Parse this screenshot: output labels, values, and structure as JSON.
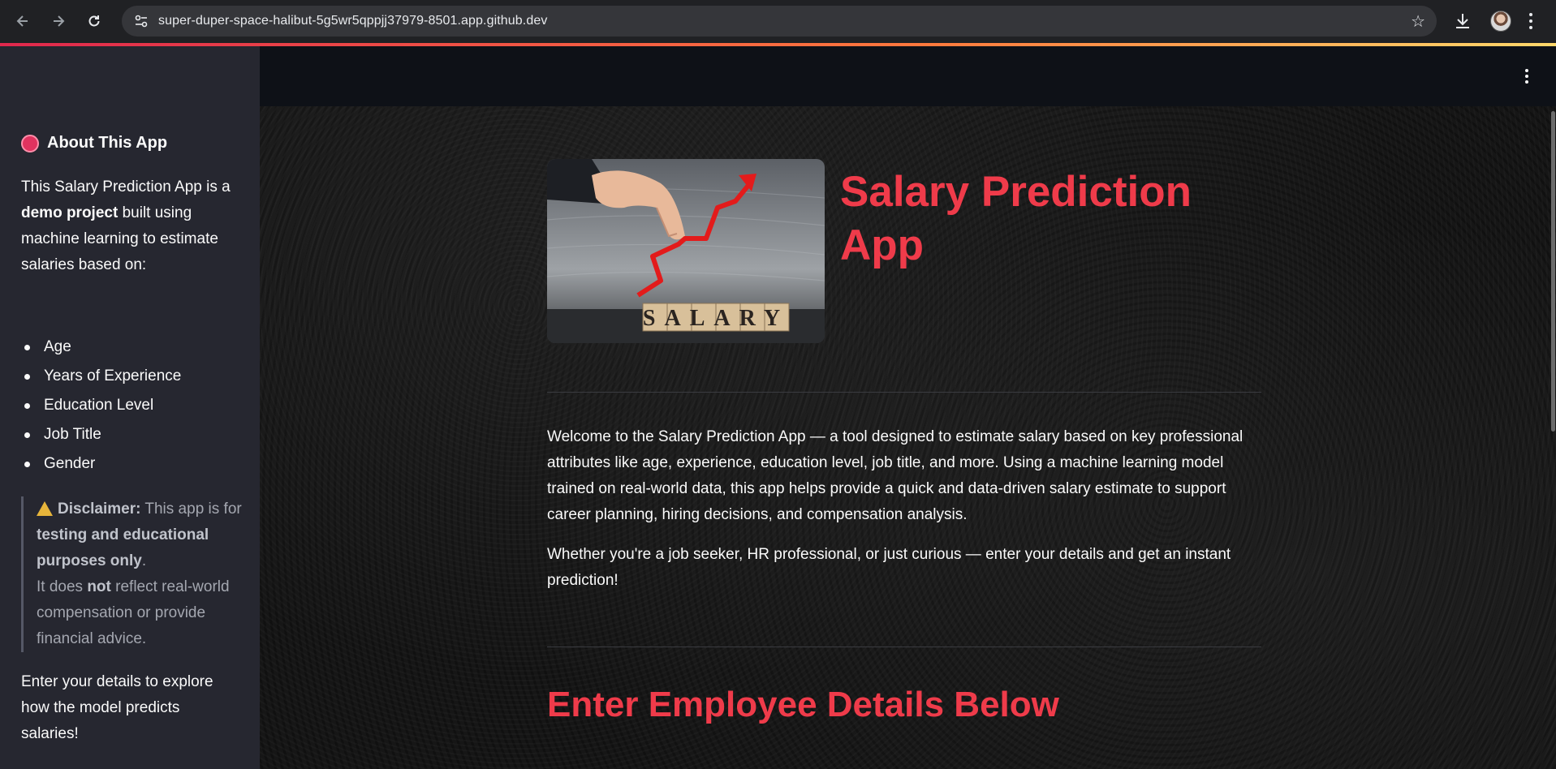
{
  "browser": {
    "url": "super-duper-space-halibut-5g5wr5qppjj37979-8501.app.github.dev",
    "back_icon": "arrow-left-icon",
    "forward_icon": "arrow-right-icon",
    "reload_icon": "reload-icon",
    "bookmark_icon": "star-icon",
    "download_icon": "download-icon",
    "menu_icon": "kebab-menu-icon",
    "accent_colors": [
      "#e0284d",
      "#ff7a3d",
      "#ffd86b"
    ]
  },
  "sidebar": {
    "title": "About This App",
    "intro_a": "This Salary Prediction App is a ",
    "intro_bold": "demo project",
    "intro_b": " built using machine learning to estimate salaries based on:",
    "features": [
      "Age",
      "Years of Experience",
      "Education Level",
      "Job Title",
      "Gender"
    ],
    "disclaimer_label": "Disclaimer:",
    "disclaimer_a": " This app is for ",
    "disclaimer_bold": "testing and educational purposes only",
    "disclaimer_b": ".",
    "disclaimer_c": "It does ",
    "disclaimer_not": "not",
    "disclaimer_d": " reflect real-world compensation or provide financial advice.",
    "footer": "Enter your details to explore how the model predicts salaries!"
  },
  "main": {
    "title": "Salary Prediction App",
    "image_text": "SALARY",
    "intro_1": "Welcome to the Salary Prediction App — a tool designed to estimate salary based on key professional attributes like age, experience, education level, job title, and more. Using a machine learning model trained on real-world data, this app helps provide a quick and data-driven salary estimate to support career planning, hiring decisions, and compensation analysis.",
    "intro_2": "Whether you're a job seeker, HR professional, or just curious — enter your details and get an instant prediction!",
    "section_title": "Enter Employee Details Below",
    "accent_color": "#ef3b4a"
  }
}
